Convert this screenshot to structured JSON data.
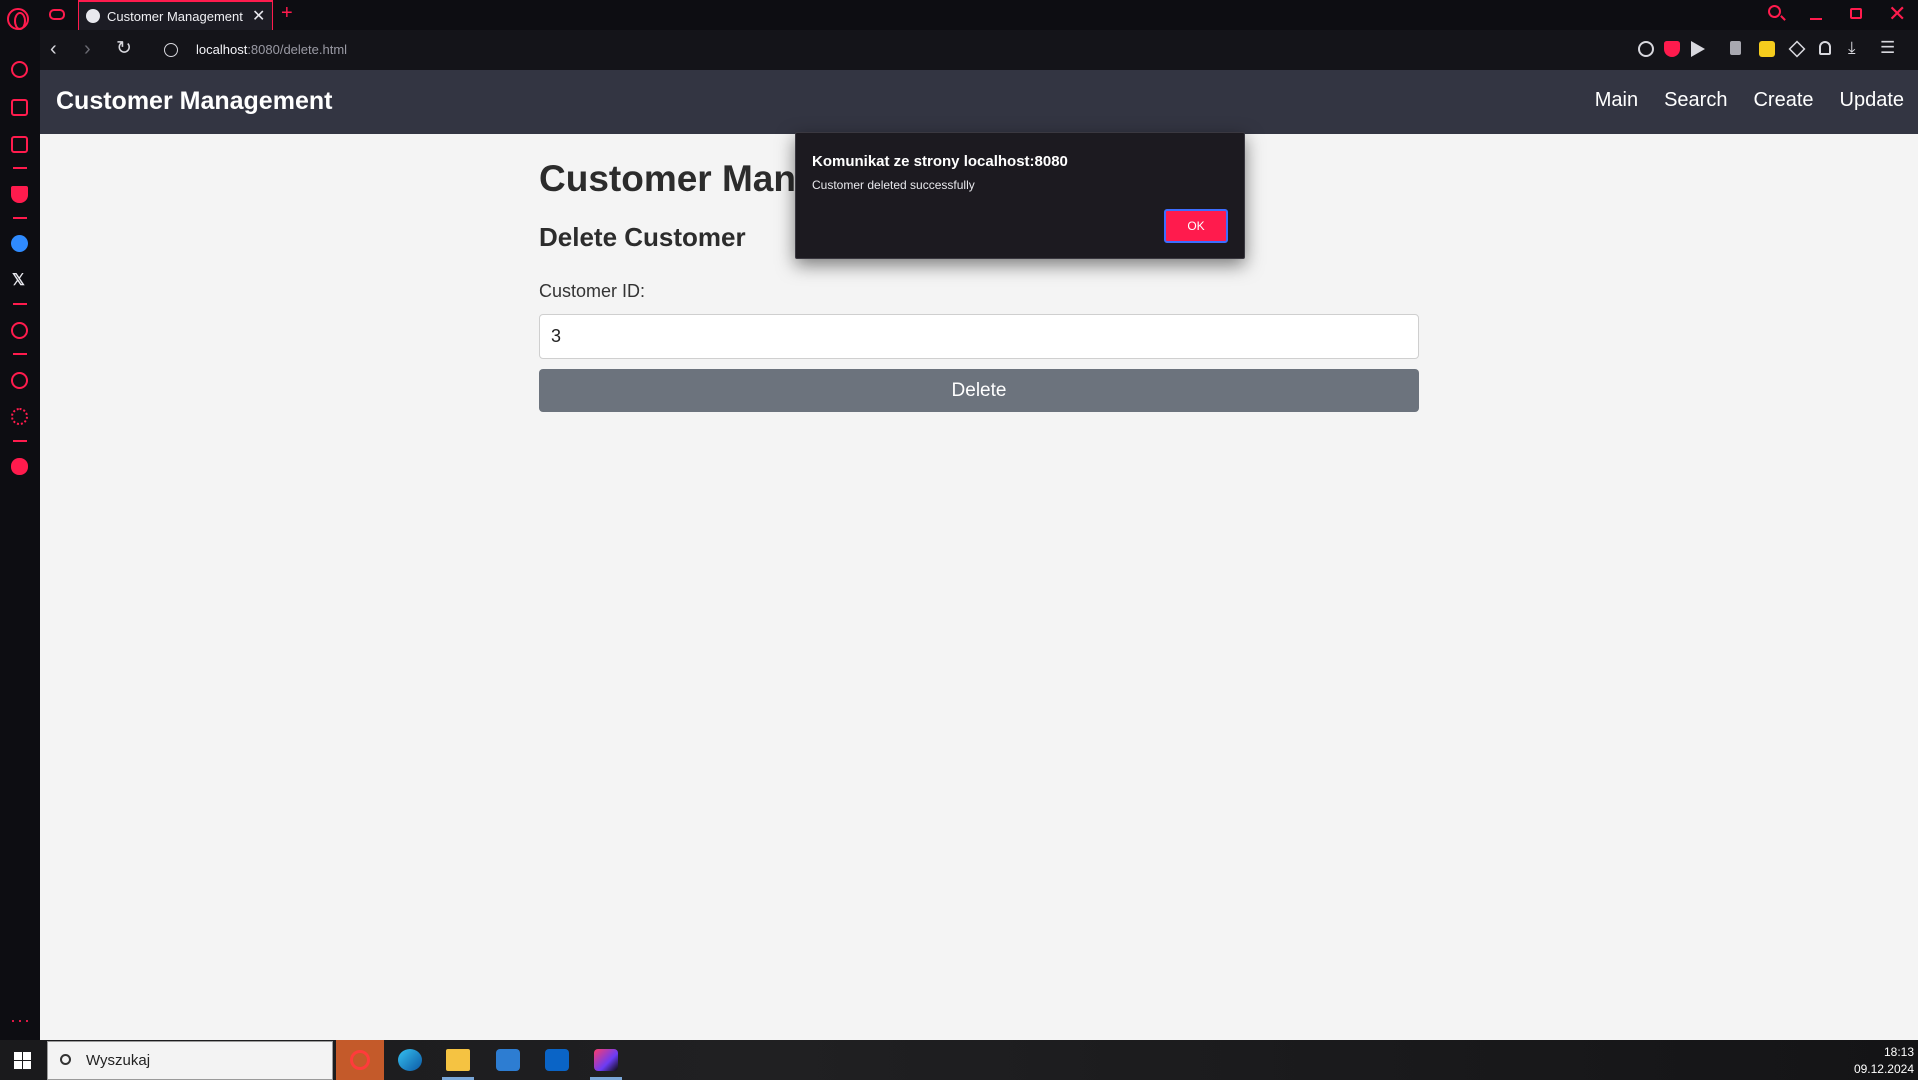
{
  "browser": {
    "tab": {
      "title": "Customer Management"
    },
    "address": {
      "host": "localhost",
      "rest": ":8080/delete.html"
    }
  },
  "site": {
    "title": "Customer Management",
    "nav": [
      "Main",
      "Search",
      "Create",
      "Update"
    ]
  },
  "page": {
    "heading": "Customer Management",
    "subheading": "Delete Customer",
    "id_label": "Customer ID:",
    "id_value": "3",
    "delete_label": "Delete"
  },
  "dialog": {
    "title": "Komunikat ze strony localhost:8080",
    "message": "Customer deleted successfully",
    "ok_label": "OK"
  },
  "taskbar": {
    "search_placeholder": "Wyszukaj",
    "time": "18:13",
    "date": "09.12.2024"
  },
  "colors": {
    "accent": "#ff1b4d",
    "header_bg": "#333542",
    "button_bg": "#6c737d"
  }
}
